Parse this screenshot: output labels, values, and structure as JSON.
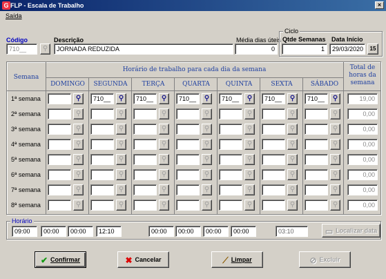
{
  "window": {
    "title": "FLP - Escala de Trabalho",
    "close_glyph": "×"
  },
  "menu": {
    "items": [
      "Saída"
    ]
  },
  "codigo": {
    "label": "Código",
    "value": "710__"
  },
  "descricao": {
    "label": "Descrição",
    "value": "JORNADA REDUZIDA"
  },
  "media": {
    "label": "Média dias úteis",
    "value": "0"
  },
  "ciclo": {
    "legend": "Ciclo",
    "qtde_label": "Qtde Semanas",
    "qtde_value": "1",
    "data_label": "Data Início",
    "data_value": "29/03/2020",
    "calendar_glyph": "15"
  },
  "grid": {
    "semana_header": "Semana",
    "horario_header": "Horário de trabalho para cada dia da semana",
    "total_header": "Total de horas da semana",
    "days": [
      "DOMINGO",
      "SEGUNDA",
      "TERÇA",
      "QUARTA",
      "QUINTA",
      "SEXTA",
      "SÁBADO"
    ],
    "rows": [
      {
        "label": "1ª semana",
        "cells": [
          "",
          "710__",
          "710__",
          "710__",
          "710__",
          "710__",
          "710__"
        ],
        "total": "19,00"
      },
      {
        "label": "2ª semana",
        "cells": [
          "",
          "",
          "",
          "",
          "",
          "",
          ""
        ],
        "total": "0,00"
      },
      {
        "label": "3ª semana",
        "cells": [
          "",
          "",
          "",
          "",
          "",
          "",
          ""
        ],
        "total": "0,00"
      },
      {
        "label": "4ª semana",
        "cells": [
          "",
          "",
          "",
          "",
          "",
          "",
          ""
        ],
        "total": "0,00"
      },
      {
        "label": "5ª semana",
        "cells": [
          "",
          "",
          "",
          "",
          "",
          "",
          ""
        ],
        "total": "0,00"
      },
      {
        "label": "6ª semana",
        "cells": [
          "",
          "",
          "",
          "",
          "",
          "",
          ""
        ],
        "total": "0,00"
      },
      {
        "label": "7ª semana",
        "cells": [
          "",
          "",
          "",
          "",
          "",
          "",
          ""
        ],
        "total": "0,00"
      },
      {
        "label": "8ª semana",
        "cells": [
          "",
          "",
          "",
          "",
          "",
          "",
          ""
        ],
        "total": "0,00"
      }
    ]
  },
  "horario": {
    "legend": "Horário",
    "times_left": [
      "09:00",
      "00:00",
      "00:00",
      "12:10"
    ],
    "times_right": [
      "00:00",
      "00:00",
      "00:00",
      "00:00"
    ],
    "total": "03:10",
    "localizar_label": "Localizar data"
  },
  "buttons": {
    "confirmar": "Confirmar",
    "cancelar": "Cancelar",
    "limpar": "Limpar",
    "excluir": "Excluir"
  },
  "icons": {
    "binoculars": "binoculars-icon",
    "check": "checkmark-icon",
    "cancel": "cancel-x-icon",
    "broom": "broom-icon",
    "delete": "delete-icon",
    "calendar": "calendar-icon"
  }
}
